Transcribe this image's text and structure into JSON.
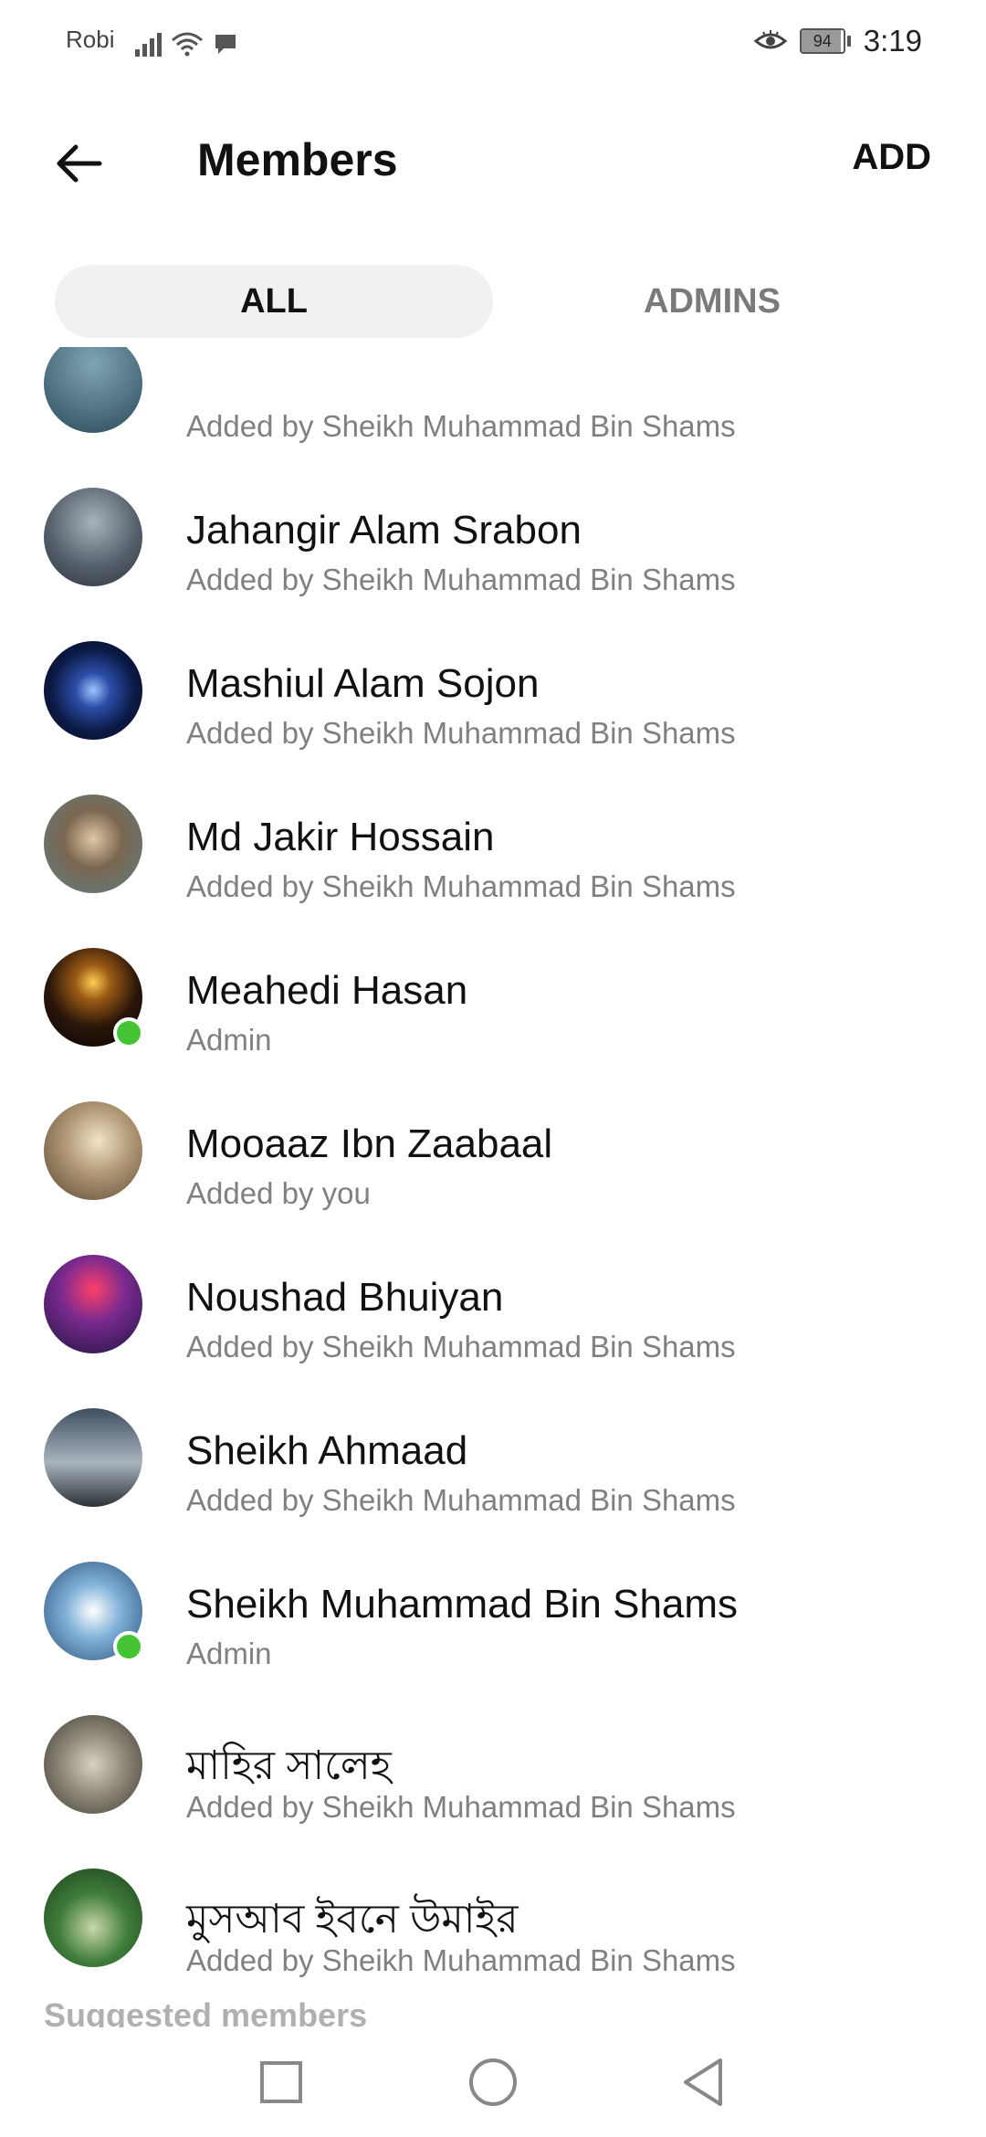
{
  "status_bar": {
    "carrier": "Robi",
    "battery": "94",
    "battery_level": 0.94,
    "time": "3:19"
  },
  "header": {
    "title": "Members",
    "add_label": "ADD",
    "back_icon": "arrow-left-icon"
  },
  "tabs": [
    {
      "label": "ALL",
      "selected": true
    },
    {
      "label": "ADMINS",
      "selected": false
    }
  ],
  "members": [
    {
      "name": "",
      "subtitle": "Added by Sheikh Muhammad Bin Shams",
      "online": false
    },
    {
      "name": "Jahangir Alam Srabon",
      "subtitle": "Added by Sheikh Muhammad Bin Shams",
      "online": false
    },
    {
      "name": "Mashiul Alam Sojon",
      "subtitle": "Added by Sheikh Muhammad Bin Shams",
      "online": false
    },
    {
      "name": "Md Jakir Hossain",
      "subtitle": "Added by Sheikh Muhammad Bin Shams",
      "online": false
    },
    {
      "name": "Meahedi Hasan",
      "subtitle": "Admin",
      "online": true
    },
    {
      "name": "Mooaaz Ibn Zaabaal",
      "subtitle": "Added by you",
      "online": false
    },
    {
      "name": "Noushad Bhuiyan",
      "subtitle": "Added by Sheikh Muhammad Bin Shams",
      "online": false
    },
    {
      "name": "Sheikh Ahmaad",
      "subtitle": "Added by Sheikh Muhammad Bin Shams",
      "online": false
    },
    {
      "name": "Sheikh Muhammad Bin Shams",
      "subtitle": "Admin",
      "online": true
    },
    {
      "name": "মাহির সালেহ",
      "subtitle": "Added by Sheikh Muhammad Bin Shams",
      "online": false
    },
    {
      "name": "মুসআব ইবনে উমাইর",
      "subtitle": "Added by Sheikh Muhammad Bin Shams",
      "online": false
    }
  ],
  "suggested_header": "Suggested members",
  "colors": {
    "online": "#43c433",
    "tab_selected_bg": "#f1f1f1",
    "subtitle": "#808080"
  },
  "nav_bar": {
    "icons": [
      "recent-apps-icon",
      "home-icon",
      "back-icon"
    ]
  }
}
